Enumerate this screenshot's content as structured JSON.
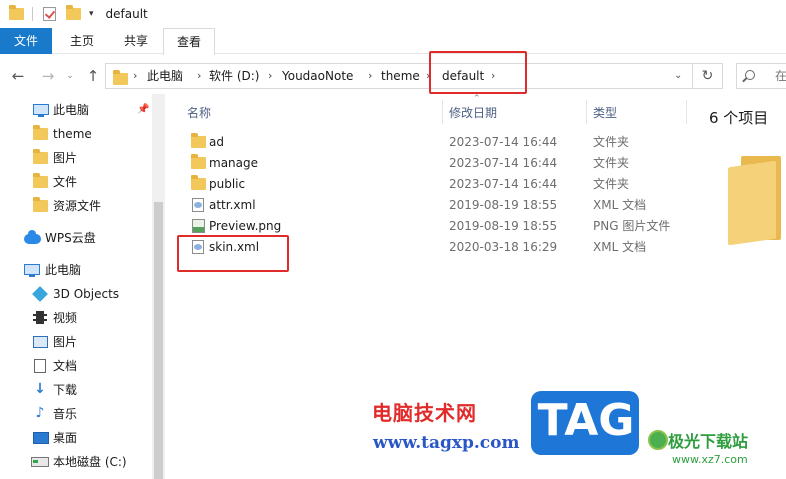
{
  "window": {
    "title": "default"
  },
  "ribbon": {
    "tabs": [
      "文件",
      "主页",
      "共享",
      "查看"
    ]
  },
  "nav": {
    "back": "←",
    "forward": "→",
    "recent": "⌄",
    "up": "↑"
  },
  "address": {
    "crumbs": [
      "此电脑",
      "软件 (D:)",
      "YoudaoNote",
      "theme",
      "default"
    ],
    "refresh": "↻"
  },
  "search": {
    "placeholder": "在"
  },
  "sidebar": {
    "quick_access": [
      {
        "label": "此电脑",
        "icon": "pc-icon",
        "pinned": true
      },
      {
        "label": "theme",
        "icon": "folder-icon"
      },
      {
        "label": "图片",
        "icon": "folder-icon"
      },
      {
        "label": "文件",
        "icon": "folder-icon"
      },
      {
        "label": "资源文件",
        "icon": "folder-icon"
      }
    ],
    "cloud": {
      "label": "WPS云盘",
      "icon": "cloud-icon"
    },
    "this_pc": {
      "label": "此电脑",
      "items": [
        {
          "label": "3D Objects",
          "icon": "cube-icon"
        },
        {
          "label": "视频",
          "icon": "film-icon"
        },
        {
          "label": "图片",
          "icon": "picture-icon"
        },
        {
          "label": "文档",
          "icon": "document-icon"
        },
        {
          "label": "下载",
          "icon": "download-icon"
        },
        {
          "label": "音乐",
          "icon": "music-icon"
        },
        {
          "label": "桌面",
          "icon": "desktop-icon"
        },
        {
          "label": "本地磁盘 (C:)",
          "icon": "disk-icon"
        }
      ]
    }
  },
  "columns": {
    "name": "名称",
    "modified": "修改日期",
    "type": "类型"
  },
  "files": [
    {
      "name": "ad",
      "modified": "2023-07-14 16:44",
      "type": "文件夹",
      "icon": "folder-icon"
    },
    {
      "name": "manage",
      "modified": "2023-07-14 16:44",
      "type": "文件夹",
      "icon": "folder-icon"
    },
    {
      "name": "public",
      "modified": "2023-07-14 16:44",
      "type": "文件夹",
      "icon": "folder-icon"
    },
    {
      "name": "attr.xml",
      "modified": "2019-08-19 18:55",
      "type": "XML 文档",
      "icon": "xml-file-icon"
    },
    {
      "name": "Preview.png",
      "modified": "2019-08-19 18:55",
      "type": "PNG 图片文件",
      "icon": "png-file-icon"
    },
    {
      "name": "skin.xml",
      "modified": "2020-03-18 16:29",
      "type": "XML 文档",
      "icon": "xml-file-icon"
    }
  ],
  "preview": {
    "count_text": "6 个项目"
  },
  "watermark": {
    "cn": "电脑技术网",
    "url": "www.tagxp.com",
    "tag": "TAG",
    "site": "极光下载站",
    "site_url": "www.xz7.com"
  },
  "colors": {
    "accent": "#1979ca",
    "highlight": "#e02b2b",
    "folder": "#f3c85a"
  }
}
